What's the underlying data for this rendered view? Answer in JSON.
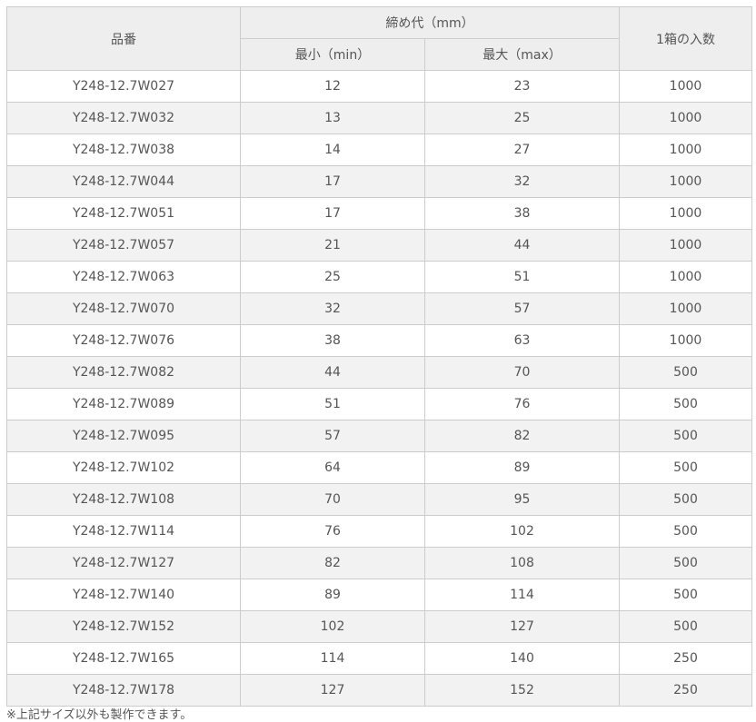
{
  "table": {
    "headers": {
      "part_number": "品番",
      "interference": "締め代（mm）",
      "min": "最小（min）",
      "max": "最大（max）",
      "per_box": "1箱の入数"
    },
    "rows": [
      {
        "part": "Y248-12.7W027",
        "min": "12",
        "max": "23",
        "qty": "1000"
      },
      {
        "part": "Y248-12.7W032",
        "min": "13",
        "max": "25",
        "qty": "1000"
      },
      {
        "part": "Y248-12.7W038",
        "min": "14",
        "max": "27",
        "qty": "1000"
      },
      {
        "part": "Y248-12.7W044",
        "min": "17",
        "max": "32",
        "qty": "1000"
      },
      {
        "part": "Y248-12.7W051",
        "min": "17",
        "max": "38",
        "qty": "1000"
      },
      {
        "part": "Y248-12.7W057",
        "min": "21",
        "max": "44",
        "qty": "1000"
      },
      {
        "part": "Y248-12.7W063",
        "min": "25",
        "max": "51",
        "qty": "1000"
      },
      {
        "part": "Y248-12.7W070",
        "min": "32",
        "max": "57",
        "qty": "1000"
      },
      {
        "part": "Y248-12.7W076",
        "min": "38",
        "max": "63",
        "qty": "1000"
      },
      {
        "part": "Y248-12.7W082",
        "min": "44",
        "max": "70",
        "qty": "500"
      },
      {
        "part": "Y248-12.7W089",
        "min": "51",
        "max": "76",
        "qty": "500"
      },
      {
        "part": "Y248-12.7W095",
        "min": "57",
        "max": "82",
        "qty": "500"
      },
      {
        "part": "Y248-12.7W102",
        "min": "64",
        "max": "89",
        "qty": "500"
      },
      {
        "part": "Y248-12.7W108",
        "min": "70",
        "max": "95",
        "qty": "500"
      },
      {
        "part": "Y248-12.7W114",
        "min": "76",
        "max": "102",
        "qty": "500"
      },
      {
        "part": "Y248-12.7W127",
        "min": "82",
        "max": "108",
        "qty": "500"
      },
      {
        "part": "Y248-12.7W140",
        "min": "89",
        "max": "114",
        "qty": "500"
      },
      {
        "part": "Y248-12.7W152",
        "min": "102",
        "max": "127",
        "qty": "500"
      },
      {
        "part": "Y248-12.7W165",
        "min": "114",
        "max": "140",
        "qty": "250"
      },
      {
        "part": "Y248-12.7W178",
        "min": "127",
        "max": "152",
        "qty": "250"
      }
    ]
  },
  "note": "※上記サイズ以外も製作できます。"
}
